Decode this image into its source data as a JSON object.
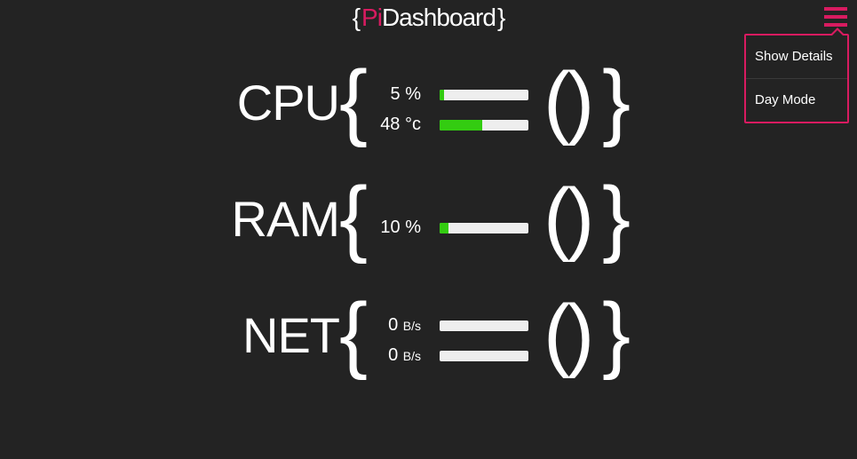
{
  "header": {
    "open_brace": "{",
    "pi": "Pi",
    "title": "Dashboard",
    "close_brace": "}"
  },
  "menu": {
    "icon": "hamburger-menu-icon",
    "items": [
      {
        "label": "Show Details"
      },
      {
        "label": "Day Mode"
      }
    ]
  },
  "colors": {
    "accent": "#d81b60",
    "bar_fill": "#33cc11",
    "bar_track": "#eeeeee",
    "background": "#232323"
  },
  "sections": {
    "cpu": {
      "label": "CPU",
      "open_brace": "{",
      "parens": "()",
      "close_brace": "}",
      "metrics": [
        {
          "value": "5",
          "unit": "%",
          "fraction": 0.05
        },
        {
          "value": "48",
          "unit": "°c",
          "fraction": 0.48
        }
      ]
    },
    "ram": {
      "label": "RAM",
      "open_brace": "{",
      "parens": "()",
      "close_brace": "}",
      "metrics": [
        {
          "value": "10",
          "unit": "%",
          "fraction": 0.1
        }
      ]
    },
    "net": {
      "label": "NET",
      "open_brace": "{",
      "parens": "()",
      "close_brace": "}",
      "metrics": [
        {
          "value": "0",
          "unit": "B/s",
          "fraction": 0
        },
        {
          "value": "0",
          "unit": "B/s",
          "fraction": 0
        }
      ]
    }
  }
}
